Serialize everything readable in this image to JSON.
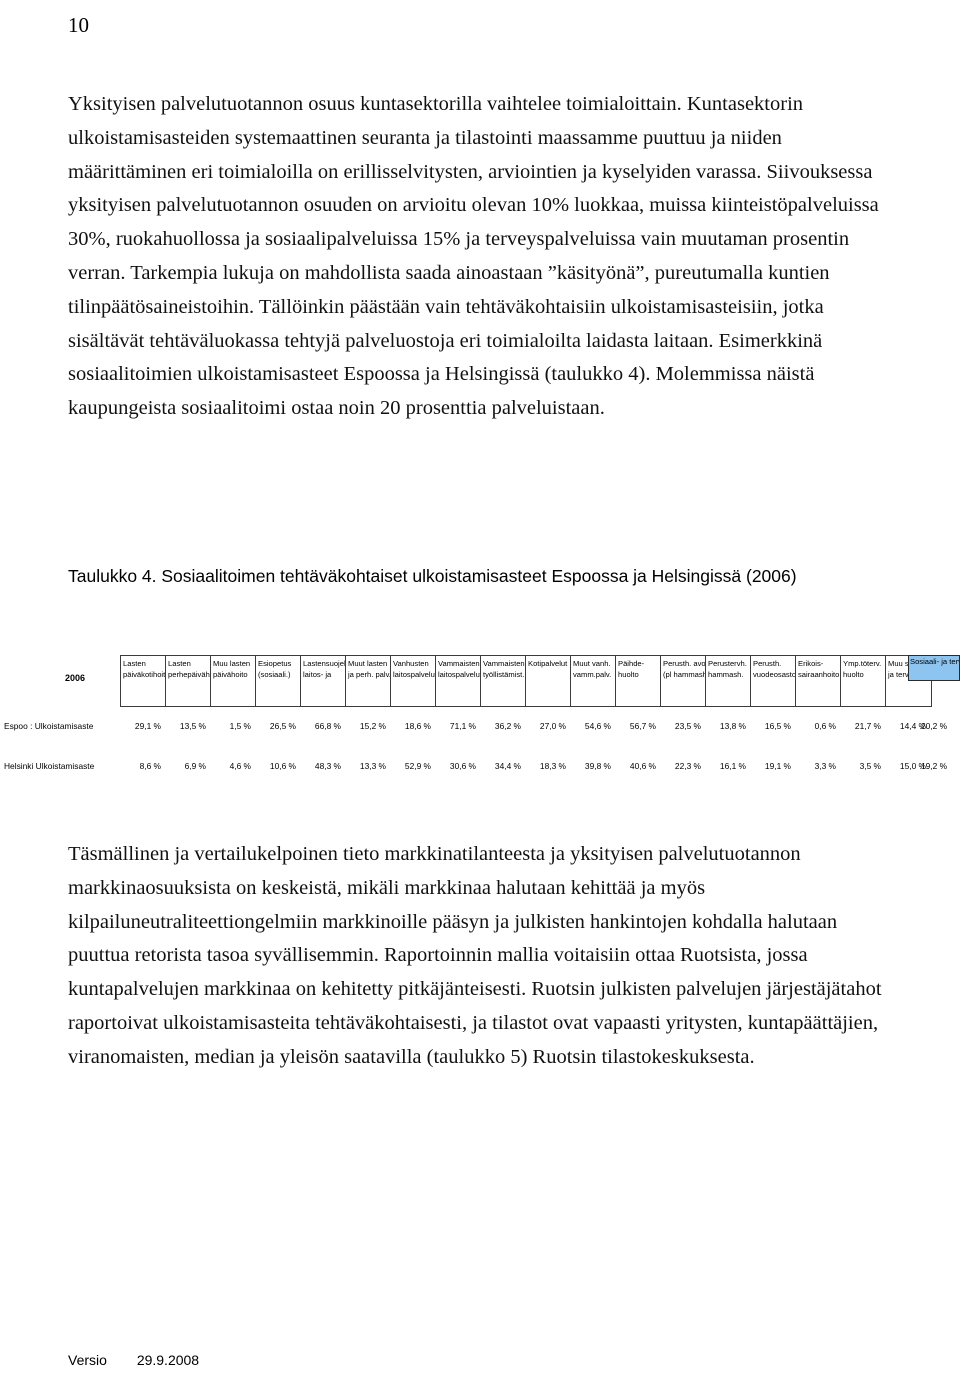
{
  "page": {
    "number": "10",
    "footer": {
      "label": "Versio",
      "date": "29.9.2008"
    }
  },
  "body": {
    "paragraph_1": "Yksityisen palvelutuotannon osuus kuntasektorilla vaihtelee toimialoittain. Kuntasektorin ulkoistamisasteiden systemaattinen seuranta ja tilastointi maassamme puuttuu ja niiden  määrittäminen eri toimialoilla on erillisselvitysten, arviointien ja kyselyiden varassa. Siivouksessa yksityisen palvelutuotannon osuuden on arvioitu olevan 10% luokkaa, muissa kiinteistöpalveluissa 30%, ruokahuollossa ja sosiaalipalveluissa 15% ja terveyspalveluissa vain muutaman prosentin verran. Tarkempia lukuja on mahdollista saada ainoastaan ”käsityönä”, pureutumalla kuntien tilinpäätösaineistoihin. Tällöinkin päästään vain tehtäväkohtaisiin ulkoistamisasteisiin, jotka sisältävät tehtäväluokassa tehtyjä palveluostoja eri toimialoilta laidasta laitaan. Esimerkkinä sosiaalitoimien ulkoistamisasteet Espoossa ja Helsingissä (taulukko 4). Molemmissa näistä kaupungeista sosiaalitoimi ostaa noin 20 prosenttia palveluistaan.",
    "paragraph_2": "Täsmällinen ja vertailukelpoinen tieto markkinatilanteesta ja yksityisen palvelutuotannon markkinaosuuksista on keskeistä, mikäli markkinaa halutaan kehittää ja myös kilpailuneutraliteettiongelmiin markkinoille pääsyn ja julkisten hankintojen kohdalla halutaan puuttua retorista tasoa syvällisemmin. Raportoinnin mallia voitaisiin ottaa Ruotsista, jossa kuntapalvelujen markkinaa on kehitetty pitkäjänteisesti. Ruotsin julkisten palvelujen järjestäjätahot raportoivat ulkoistamisasteita tehtäväkohtaisesti, ja tilastot ovat vapaasti yritysten, kuntapäättäjien, viranomaisten, median ja yleisön saatavilla (taulukko 5) Ruotsin tilastokeskuksesta."
  },
  "table": {
    "caption": "Taulukko 4. Sosiaalitoimen tehtäväkohtaiset ulkoistamisasteet Espoossa ja Helsingissä (2006)",
    "year_label": "2006",
    "highlight_color": "#8ec5f0",
    "total_header": {
      "line1": "Sosiaali-",
      "line2": "ja terveystoimi"
    },
    "headers": [
      {
        "line1": "Lasten",
        "line2": "päiväkotihoito"
      },
      {
        "line1": "Lasten",
        "line2": "perhepäivähoito"
      },
      {
        "line1": "Muu lasten",
        "line2": "päivähoito"
      },
      {
        "line1": "Esiopetus",
        "line2": "(sosiaali.)"
      },
      {
        "line1": "Lastensuojelun",
        "line2": "laitos- ja"
      },
      {
        "line1": "Muut lasten",
        "line2": "ja perh. palv."
      },
      {
        "line1": "Vanhusten",
        "line2": "laitospalvelut"
      },
      {
        "line1": "Vammaisten",
        "line2": "laitospalvelut"
      },
      {
        "line1": "Vammaisten",
        "line2": "työllistämist."
      },
      {
        "line1": "Kotipalvelut",
        "line2": ""
      },
      {
        "line1": "Muut vanh.",
        "line2": "vamm.palv."
      },
      {
        "line1": "Päihde-",
        "line2": "huolto"
      },
      {
        "line1": "Perusth. avoh.",
        "line2": "(pl hammash.)"
      },
      {
        "line1": "Perustervh.",
        "line2": "hammash."
      },
      {
        "line1": "Perusth.",
        "line2": "vuodeosastoh."
      },
      {
        "line1": "Erikois-",
        "line2": "sairaanhoito"
      },
      {
        "line1": "Ymp.töterv.",
        "line2": "huolto"
      },
      {
        "line1": "Muu sos.",
        "line2": "ja terveyst."
      }
    ],
    "rows": [
      {
        "label": "Espoo : Ulkoistamisaste",
        "values": [
          "29,1 %",
          "13,5 %",
          "1,5 %",
          "26,5 %",
          "66,8 %",
          "15,2 %",
          "18,6 %",
          "71,1 %",
          "36,2 %",
          "27,0 %",
          "54,6 %",
          "56,7 %",
          "23,5 %",
          "13,8 %",
          "16,5 %",
          "0,6 %",
          "21,7 %",
          "14,4 %"
        ],
        "total": "20,2 %"
      },
      {
        "label": "Helsinki Ulkoistamisaste",
        "values": [
          "8,6 %",
          "6,9 %",
          "4,6 %",
          "10,6 %",
          "48,3 %",
          "13,3 %",
          "52,9 %",
          "30,6 %",
          "34,4 %",
          "18,3 %",
          "39,8 %",
          "40,6 %",
          "22,3 %",
          "16,1 %",
          "19,1 %",
          "3,3 %",
          "3,5 %",
          "15,0 %"
        ],
        "total": "19,2 %"
      }
    ]
  }
}
